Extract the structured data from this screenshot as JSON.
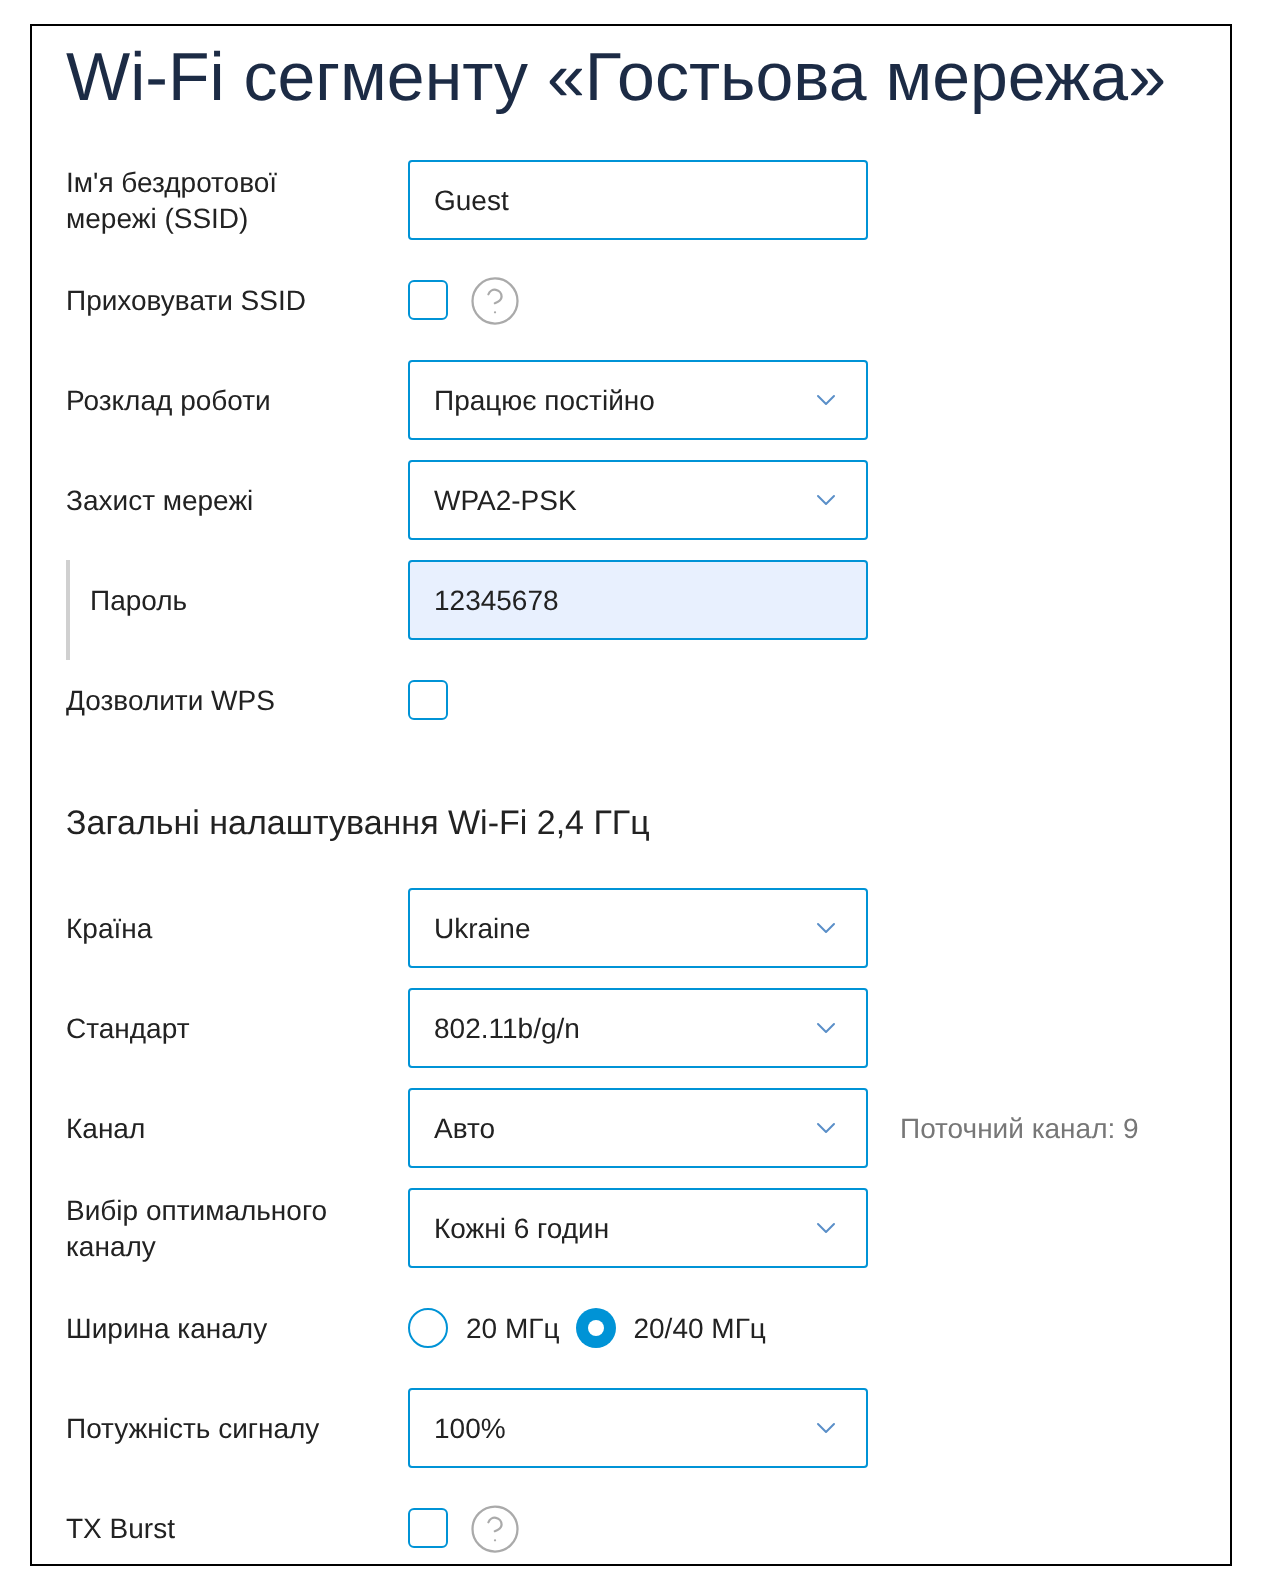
{
  "title": "Wi-Fi сегменту «Гостьова мережа»",
  "rows": [
    {
      "kind": "text",
      "label": "Ім'я бездротової мережі (SSID)",
      "value": "Guest",
      "indented": false,
      "highlighted": false
    },
    {
      "kind": "checkbox",
      "label": "Приховувати SSID",
      "checked": false,
      "help": true
    },
    {
      "kind": "select",
      "label": "Розклад роботи",
      "value": "Працює постійно"
    },
    {
      "kind": "select",
      "label": "Захист мережі",
      "value": "WPA2-PSK"
    },
    {
      "kind": "text",
      "label": "Пароль",
      "value": "12345678",
      "indented": true,
      "highlighted": true
    },
    {
      "kind": "checkbox",
      "label": "Дозволити WPS",
      "checked": false,
      "help": false
    }
  ],
  "section": {
    "heading": "Загальні налаштування Wi-Fi 2,4 ГГц",
    "rows": [
      {
        "kind": "select",
        "label": "Країна",
        "value": "Ukraine"
      },
      {
        "kind": "select",
        "label": "Стандарт",
        "value": "802.11b/g/n"
      },
      {
        "kind": "select",
        "label": "Канал",
        "value": "Авто",
        "note": "Поточний канал: 9"
      },
      {
        "kind": "select",
        "label": "Вибір оптимального каналу",
        "value": "Кожні 6 годин"
      },
      {
        "kind": "radio",
        "label": "Ширина каналу",
        "options": [
          {
            "label": "20 МГц",
            "selected": false
          },
          {
            "label": "20/40 МГц",
            "selected": true
          }
        ]
      },
      {
        "kind": "select",
        "label": "Потужність сигналу",
        "value": "100%"
      },
      {
        "kind": "checkbox",
        "label": "TX Burst",
        "checked": false,
        "help": true
      }
    ]
  }
}
